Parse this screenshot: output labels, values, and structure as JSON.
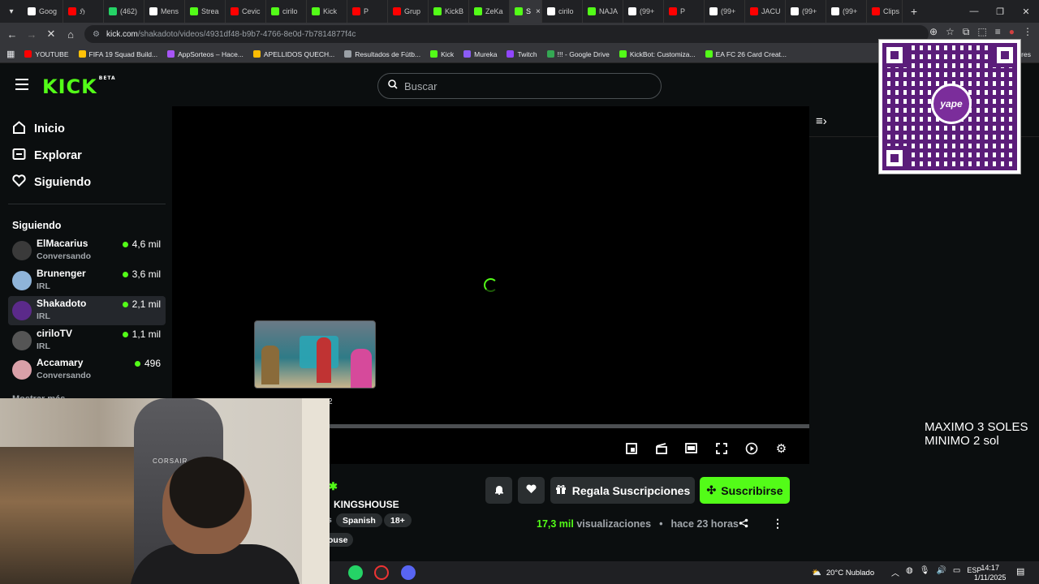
{
  "browser": {
    "tabs": [
      {
        "label": "Goog",
        "color": "#ffffff"
      },
      {
        "label": "ℌ",
        "color": "#ff0000"
      },
      {
        "label": "(462)",
        "color": "#25d366"
      },
      {
        "label": "Mens",
        "color": "#ffffff"
      },
      {
        "label": "Strea",
        "color": "#53fc18"
      },
      {
        "label": "Cevic",
        "color": "#ff0000"
      },
      {
        "label": "cirilo",
        "color": "#53fc18"
      },
      {
        "label": "Kick",
        "color": "#53fc18"
      },
      {
        "label": "P",
        "color": "#ff0000"
      },
      {
        "label": "Grup",
        "color": "#ff0000"
      },
      {
        "label": "KickB",
        "color": "#53fc18"
      },
      {
        "label": "ZeKa",
        "color": "#53fc18"
      },
      {
        "label": "S",
        "color": "#53fc18",
        "active": true
      },
      {
        "label": "cirilo",
        "color": "#ffffff"
      },
      {
        "label": "NAJA",
        "color": "#53fc18"
      },
      {
        "label": "(99+",
        "color": "#ffffff"
      },
      {
        "label": "P",
        "color": "#ff0000"
      },
      {
        "label": "(99+",
        "color": "#ffffff"
      },
      {
        "label": "JACU",
        "color": "#ff0000"
      },
      {
        "label": "(99+",
        "color": "#ffffff"
      },
      {
        "label": "(99+",
        "color": "#ffffff"
      },
      {
        "label": "Clips",
        "color": "#ff0000"
      }
    ],
    "active_tab_close": "×",
    "new_tab": "+",
    "url_host": "kick.com",
    "url_path": "/shakadoto/videos/4931df48-b9b7-4766-8e0d-7b7814877f4c",
    "bookmarks": [
      {
        "label": "YOUTUBE",
        "color": "#ff0000"
      },
      {
        "label": "FIFA 19 Squad Build...",
        "color": "#ffc107"
      },
      {
        "label": "AppSorteos – Hace...",
        "color": "#a855f7"
      },
      {
        "label": "APELLIDOS QUECH...",
        "color": "#fbbc04"
      },
      {
        "label": "Resultados de Fútb...",
        "color": "#9aa0a6"
      },
      {
        "label": "Kick",
        "color": "#53fc18"
      },
      {
        "label": "Mureka",
        "color": "#8b5cf6"
      },
      {
        "label": "Twitch",
        "color": "#9146ff"
      },
      {
        "label": "!!! - Google Drive",
        "color": "#34a853"
      },
      {
        "label": "KickBot: Customiza...",
        "color": "#53fc18"
      },
      {
        "label": "EA FC 26 Card Creat...",
        "color": "#53fc18"
      }
    ],
    "bookmarks_tail": "ores"
  },
  "kick": {
    "logo": "KICK",
    "logo_badge": "BETA",
    "search_placeholder": "Buscar",
    "nav": [
      {
        "label": "Inicio",
        "icon": "home-icon"
      },
      {
        "label": "Explorar",
        "icon": "explore-icon"
      },
      {
        "label": "Siguiendo",
        "icon": "heart-icon"
      }
    ],
    "following_heading": "Siguiendo",
    "following": [
      {
        "name": "ElMacarius",
        "category": "Conversando",
        "viewers": "4,6 mil",
        "avatar_color": "#3a3a3a"
      },
      {
        "name": "Brunenger",
        "category": "IRL",
        "viewers": "3,6 mil",
        "avatar_color": "#8fb4d9"
      },
      {
        "name": "Shakadoto",
        "category": "IRL",
        "viewers": "2,1 mil",
        "avatar_color": "#5b2a8a",
        "selected": true
      },
      {
        "name": "ciriloTV",
        "category": "IRL",
        "viewers": "1,1 mil",
        "avatar_color": "#555555"
      },
      {
        "name": "Accamary",
        "category": "Conversando",
        "viewers": "496",
        "avatar_color": "#d9a0a8"
      }
    ],
    "show_more": "Mostrar más",
    "preview_number": "2",
    "channel_title_fragment": "KINGSHOUSE",
    "tag_fragment": "s",
    "tags": [
      "Spanish",
      "18+"
    ],
    "category_fragment": "ouse",
    "gift_label": "Regala Suscripciones",
    "subscribe_label": "Suscribirse",
    "views_count": "17,3 mil",
    "views_label": "visualizaciones",
    "time_ago": "hace 23 horas"
  },
  "overlay": {
    "qr_brand": "yape",
    "text_line1": "MAXIMO 3 SOLES",
    "text_line2": "MINIMO 2 sol",
    "webcam_chair_brand": "CORSAIR"
  },
  "taskbar": {
    "weather": "20°C  Nublado",
    "language": "ESP",
    "time": "14:17",
    "date": "1/11/2025"
  }
}
